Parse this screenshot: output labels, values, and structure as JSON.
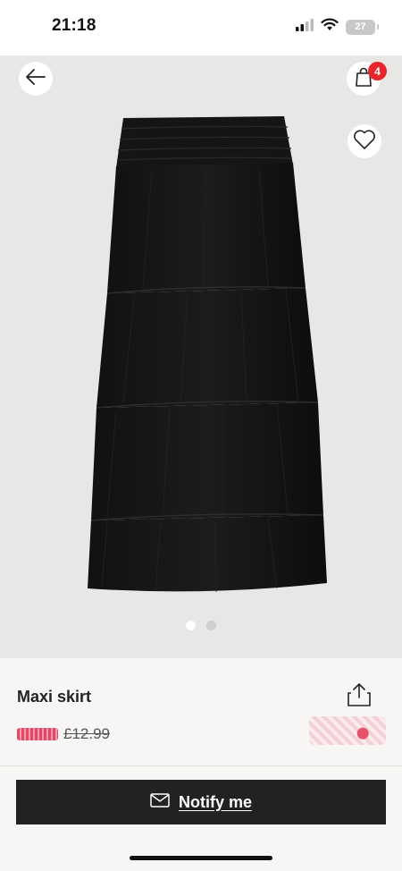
{
  "status_bar": {
    "time": "21:18",
    "battery": "27",
    "icons": [
      "signal-icon",
      "wifi-icon",
      "battery-icon"
    ]
  },
  "gallery": {
    "image_alt": "black tiered maxi skirt",
    "back_icon": "arrow-left-icon",
    "bag_icon": "shopping-bag-icon",
    "bag_count": "4",
    "favorite_icon": "heart-icon",
    "slides": 2,
    "active_slide": 1
  },
  "product": {
    "title": "Maxi skirt",
    "old_price": "£12.99",
    "share_icon": "share-icon"
  },
  "actions": {
    "notify_label": "Notify me",
    "notify_icon": "envelope-icon"
  },
  "colors": {
    "badge": "#e6262c",
    "button_bg": "#222222",
    "image_bg": "#e8e7e5"
  }
}
